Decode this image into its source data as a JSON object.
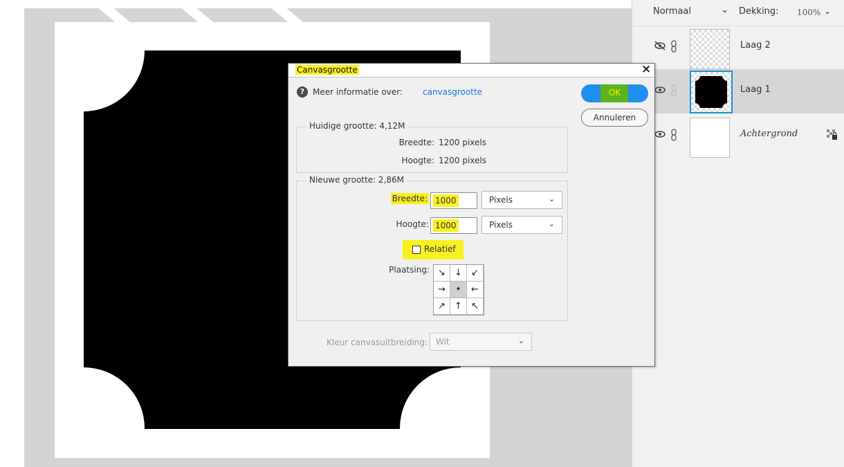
{
  "layers_panel": {
    "blend_mode": "Normaal",
    "opacity_label": "Dekking:",
    "opacity_value": "100%",
    "layers": [
      {
        "name": "Laag 2",
        "visible": false,
        "thumb": "transparent"
      },
      {
        "name": "Laag 1",
        "visible": true,
        "thumb": "black-shape",
        "selected": true
      },
      {
        "name": "Achtergrond",
        "visible": true,
        "thumb": "white",
        "locked": true
      }
    ]
  },
  "dialog": {
    "title": "Canvasgrootte",
    "info_label": "Meer informatie over:",
    "info_link": "canvasgrootte",
    "ok_label": "OK",
    "cancel_label": "Annuleren",
    "current_size": {
      "legend": "Huidige grootte: 4,12M",
      "width_label": "Breedte:",
      "width_value": "1200 pixels",
      "height_label": "Hoogte:",
      "height_value": "1200 pixels"
    },
    "new_size": {
      "legend": "Nieuwe grootte: 2,86M",
      "width_label": "Breedte:",
      "width_value": "1000",
      "width_unit": "Pixels",
      "height_label": "Hoogte:",
      "height_value": "1000",
      "height_unit": "Pixels",
      "relative_label": "Relatief",
      "relative_checked": false,
      "anchor_label": "Plaatsing:",
      "anchor_arrows": [
        "↘",
        "↓",
        "↙",
        "→",
        "•",
        "←",
        "↗",
        "↑",
        "↖"
      ]
    },
    "extension_color_label": "Kleur canvasuitbreiding:",
    "extension_color_value": "Wit"
  },
  "colors": {
    "highlight": "#f8f01f",
    "ok_blue": "#1f8ef1",
    "link_blue": "#1473e6",
    "workspace": "#d4d4d4"
  }
}
